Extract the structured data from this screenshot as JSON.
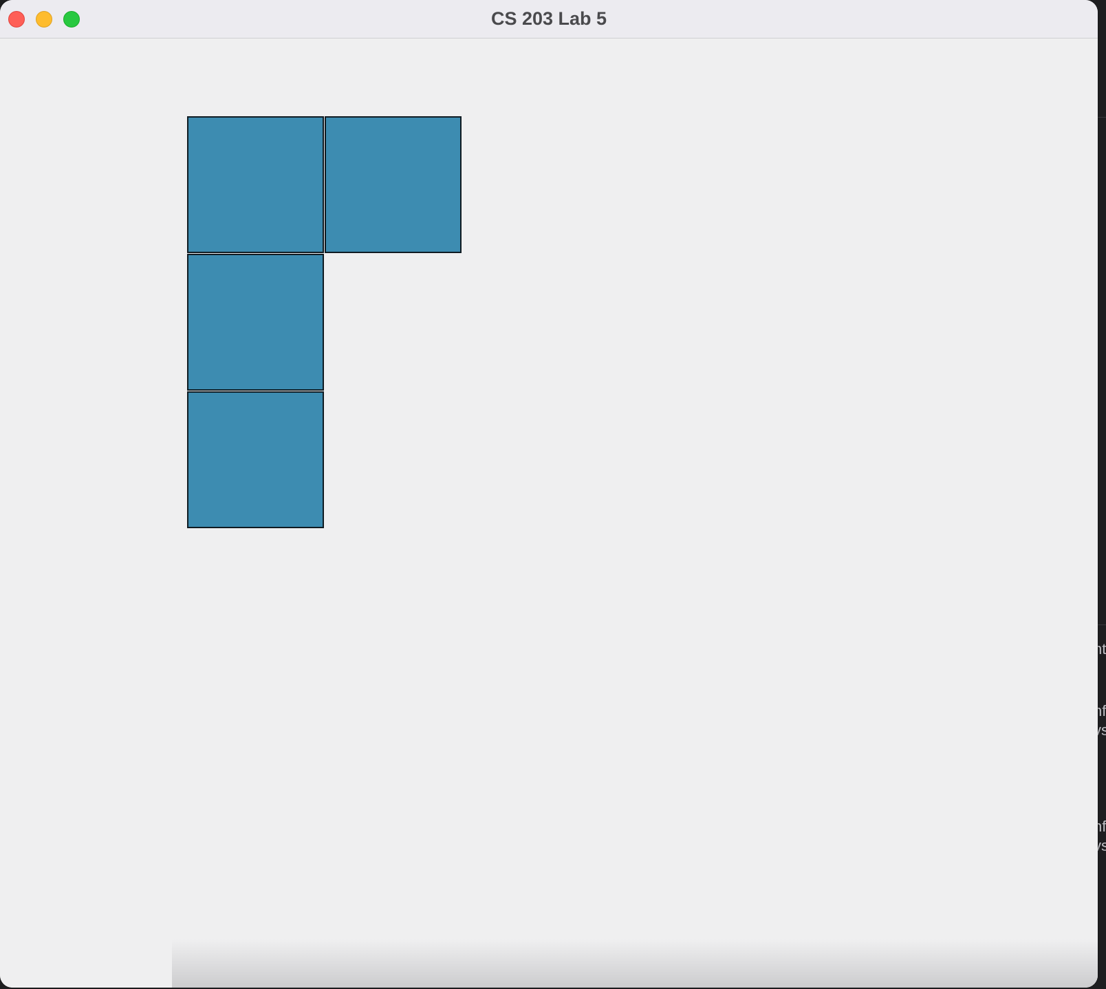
{
  "window": {
    "title": "CS 203 Lab 5"
  },
  "colors": {
    "tile_fill": "#3d8cb1",
    "tile_border": "#0f1b22",
    "canvas_background": "#efeff0"
  },
  "grid": {
    "cells": [
      {
        "row": 0,
        "col": 0
      },
      {
        "row": 0,
        "col": 1
      },
      {
        "row": 1,
        "col": 0
      },
      {
        "row": 2,
        "col": 0
      }
    ]
  },
  "background_fragments": [
    "nt",
    "nf",
    "vs",
    "nf",
    "vs"
  ]
}
